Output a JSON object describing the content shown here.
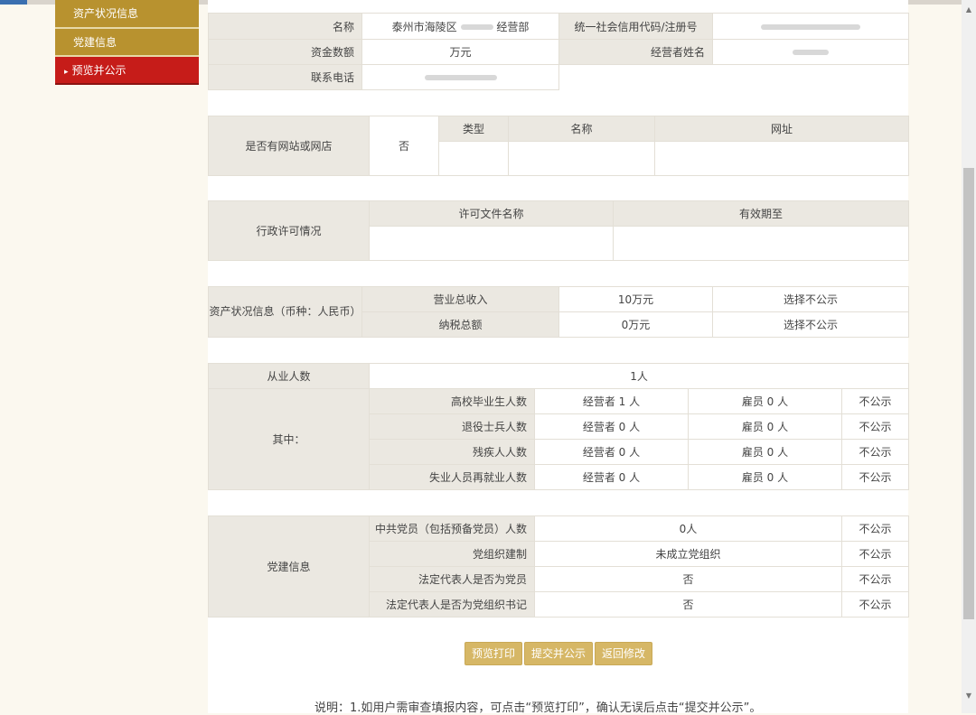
{
  "sidebar": {
    "items": [
      {
        "label": "资产状况信息"
      },
      {
        "label": "党建信息"
      },
      {
        "label": "预览并公示"
      }
    ],
    "active_arrow": "▸"
  },
  "basic": {
    "name_label": "名称",
    "name_value": "泰州市海陵区",
    "name_suffix": "经营部",
    "credit_label": "统一社会信用代码/注册号",
    "capital_label": "资金数额",
    "capital_value": "万元",
    "operator_label": "经营者姓名",
    "phone_label": "联系电话"
  },
  "website": {
    "question": "是否有网站或网店",
    "answer": "否",
    "headers": [
      "类型",
      "名称",
      "网址"
    ]
  },
  "permit": {
    "label": "行政许可情况",
    "headers": [
      "许可文件名称",
      "有效期至"
    ]
  },
  "assets": {
    "label": "资产状况信息（币种：人民币）",
    "rows": [
      {
        "name": "营业总收入",
        "value": "10万元",
        "public": "选择不公示"
      },
      {
        "name": "纳税总额",
        "value": "0万元",
        "public": "选择不公示"
      }
    ]
  },
  "employees": {
    "label": "从业人数",
    "value": "1人",
    "among_label": "其中：",
    "rows": [
      {
        "name": "高校毕业生人数",
        "operator": "经营者 1 人",
        "employee": "雇员 0 人",
        "public": "不公示"
      },
      {
        "name": "退役士兵人数",
        "operator": "经营者 0 人",
        "employee": "雇员 0 人",
        "public": "不公示"
      },
      {
        "name": "残疾人人数",
        "operator": "经营者 0 人",
        "employee": "雇员 0 人",
        "public": "不公示"
      },
      {
        "name": "失业人员再就业人数",
        "operator": "经营者 0 人",
        "employee": "雇员 0 人",
        "public": "不公示"
      }
    ]
  },
  "party": {
    "label": "党建信息",
    "rows": [
      {
        "name": "中共党员（包括预备党员）人数",
        "value": "0人",
        "public": "不公示"
      },
      {
        "name": "党组织建制",
        "value": "未成立党组织",
        "public": "不公示"
      },
      {
        "name": "法定代表人是否为党员",
        "value": "否",
        "public": "不公示"
      },
      {
        "name": "法定代表人是否为党组织书记",
        "value": "否",
        "public": "不公示"
      }
    ]
  },
  "buttons": {
    "preview_print": "预览打印",
    "submit_publish": "提交并公示",
    "back_edit": "返回修改"
  },
  "note": "说明：1.如用户需审查填报内容，可点击“预览打印”，确认无误后点击“提交并公示”。",
  "colors": {
    "sidebar_gold": "#b8922f",
    "sidebar_active_red": "#c61c19",
    "button_gold": "#d6b766",
    "header_gray": "#ebe8e1"
  }
}
